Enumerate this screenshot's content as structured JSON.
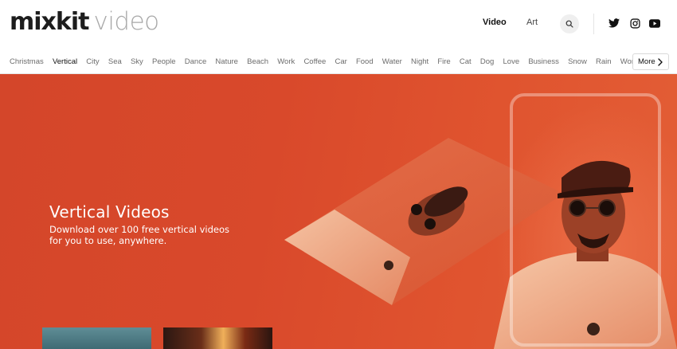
{
  "header": {
    "logo_brand": "mixkit",
    "logo_product": "video",
    "nav": {
      "video": "Video",
      "art": "Art"
    }
  },
  "categories": [
    "Christmas",
    "Vertical",
    "City",
    "Sea",
    "Sky",
    "People",
    "Dance",
    "Nature",
    "Beach",
    "Work",
    "Coffee",
    "Car",
    "Food",
    "Water",
    "Night",
    "Fire",
    "Cat",
    "Dog",
    "Love",
    "Business",
    "Snow",
    "Rain",
    "Woman"
  ],
  "active_category": "Vertical",
  "more_label": "More",
  "hero": {
    "title": "Vertical Videos",
    "subtitle": "Download over 100 free vertical videos for you to use, anywhere."
  },
  "colors": {
    "hero": "#d9492b",
    "brand_text": "#1d1d1d",
    "logo_grey": "#a9a9a9"
  },
  "icons": [
    "search-icon",
    "twitter-icon",
    "instagram-icon",
    "youtube-icon",
    "chevron-right-icon"
  ]
}
